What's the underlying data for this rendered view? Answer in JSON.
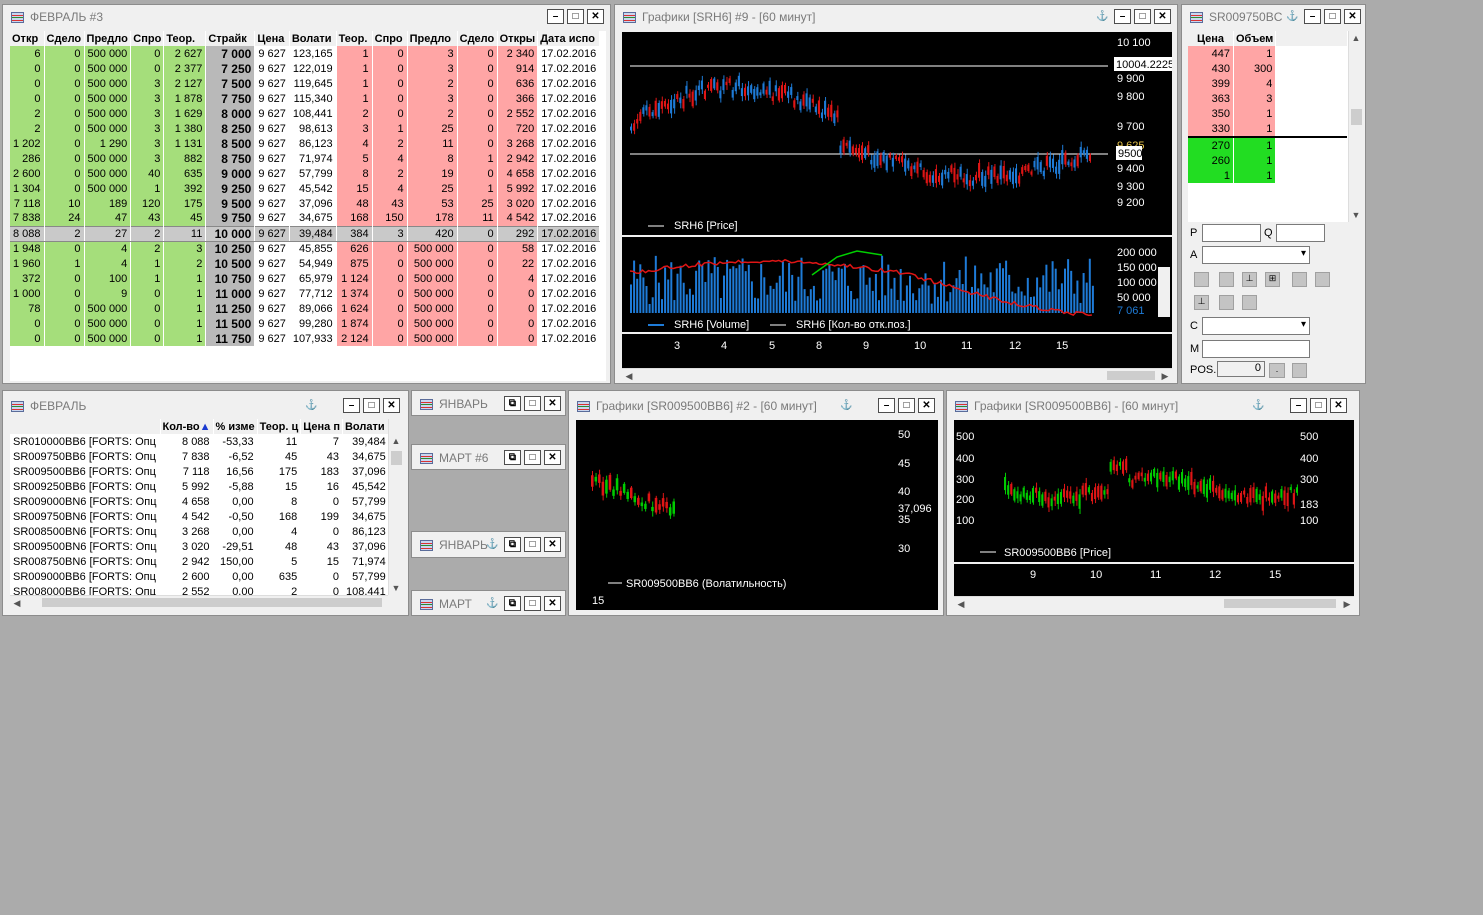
{
  "feb3": {
    "title": "ФЕВРАЛЬ #3",
    "headers": [
      "Откр",
      "Сдело",
      "Предло",
      "Спро",
      "Теор.",
      "Страйк",
      "Цена",
      "Волати",
      "Теор.",
      "Спро",
      "Предло",
      "Сдело",
      "Откры",
      "Дата испо"
    ],
    "rows": [
      [
        "6",
        "0",
        "500 000",
        "0",
        "2 627",
        "7 000",
        "9 627",
        "123,165",
        "1",
        "0",
        "3",
        "0",
        "2 340",
        "17.02.2016"
      ],
      [
        "0",
        "0",
        "500 000",
        "0",
        "2 377",
        "7 250",
        "9 627",
        "122,019",
        "1",
        "0",
        "3",
        "0",
        "914",
        "17.02.2016"
      ],
      [
        "0",
        "0",
        "500 000",
        "3",
        "2 127",
        "7 500",
        "9 627",
        "119,645",
        "1",
        "0",
        "2",
        "0",
        "636",
        "17.02.2016"
      ],
      [
        "0",
        "0",
        "500 000",
        "3",
        "1 878",
        "7 750",
        "9 627",
        "115,340",
        "1",
        "0",
        "3",
        "0",
        "366",
        "17.02.2016"
      ],
      [
        "2",
        "0",
        "500 000",
        "3",
        "1 629",
        "8 000",
        "9 627",
        "108,441",
        "2",
        "0",
        "2",
        "0",
        "2 552",
        "17.02.2016"
      ],
      [
        "2",
        "0",
        "500 000",
        "3",
        "1 380",
        "8 250",
        "9 627",
        "98,613",
        "3",
        "1",
        "25",
        "0",
        "720",
        "17.02.2016"
      ],
      [
        "1 202",
        "0",
        "1 290",
        "3",
        "1 131",
        "8 500",
        "9 627",
        "86,123",
        "4",
        "2",
        "11",
        "0",
        "3 268",
        "17.02.2016"
      ],
      [
        "286",
        "0",
        "500 000",
        "3",
        "882",
        "8 750",
        "9 627",
        "71,974",
        "5",
        "4",
        "8",
        "1",
        "2 942",
        "17.02.2016"
      ],
      [
        "2 600",
        "0",
        "500 000",
        "40",
        "635",
        "9 000",
        "9 627",
        "57,799",
        "8",
        "2",
        "19",
        "0",
        "4 658",
        "17.02.2016"
      ],
      [
        "1 304",
        "0",
        "500 000",
        "1",
        "392",
        "9 250",
        "9 627",
        "45,542",
        "15",
        "4",
        "25",
        "1",
        "5 992",
        "17.02.2016"
      ],
      [
        "7 118",
        "10",
        "189",
        "120",
        "175",
        "9 500",
        "9 627",
        "37,096",
        "48",
        "43",
        "53",
        "25",
        "3 020",
        "17.02.2016"
      ],
      [
        "7 838",
        "24",
        "47",
        "43",
        "45",
        "9 750",
        "9 627",
        "34,675",
        "168",
        "150",
        "178",
        "11",
        "4 542",
        "17.02.2016"
      ],
      [
        "8 088",
        "2",
        "27",
        "2",
        "11",
        "10 000",
        "9 627",
        "39,484",
        "384",
        "3",
        "420",
        "0",
        "292",
        "17.02.2016"
      ],
      [
        "1 948",
        "0",
        "4",
        "2",
        "3",
        "10 250",
        "9 627",
        "45,855",
        "626",
        "0",
        "500 000",
        "0",
        "58",
        "17.02.2016"
      ],
      [
        "1 960",
        "1",
        "4",
        "1",
        "2",
        "10 500",
        "9 627",
        "54,949",
        "875",
        "0",
        "500 000",
        "0",
        "22",
        "17.02.2016"
      ],
      [
        "372",
        "0",
        "100",
        "1",
        "1",
        "10 750",
        "9 627",
        "65,979",
        "1 124",
        "0",
        "500 000",
        "0",
        "4",
        "17.02.2016"
      ],
      [
        "1 000",
        "0",
        "9",
        "0",
        "1",
        "11 000",
        "9 627",
        "77,712",
        "1 374",
        "0",
        "500 000",
        "0",
        "0",
        "17.02.2016"
      ],
      [
        "78",
        "0",
        "500 000",
        "0",
        "1",
        "11 250",
        "9 627",
        "89,066",
        "1 624",
        "0",
        "500 000",
        "0",
        "0",
        "17.02.2016"
      ],
      [
        "0",
        "0",
        "500 000",
        "0",
        "1",
        "11 500",
        "9 627",
        "99,280",
        "1 874",
        "0",
        "500 000",
        "0",
        "0",
        "17.02.2016"
      ],
      [
        "0",
        "0",
        "500 000",
        "0",
        "1",
        "11 750",
        "9 627",
        "107,933",
        "2 124",
        "0",
        "500 000",
        "0",
        "0",
        "17.02.2016"
      ]
    ]
  },
  "srh6": {
    "title": "Графики [SRH6] #9 - [60 минут]",
    "price_ticks": [
      "10 100",
      "9 900",
      "9 800",
      "9 700",
      "9 625",
      "9 400",
      "9 300",
      "9 200"
    ],
    "level_hi": "10004.2225",
    "level_lo": "9500",
    "price_legend": "SRH6 [Price]",
    "vol_ticks": [
      "200 000",
      "150 000",
      "100 000",
      "50 000"
    ],
    "vol_last": "7 061",
    "vol_legend_1": "SRH6 [Volume]",
    "vol_legend_2": "SRH6 [Кол-во отк.поз.]",
    "x_ticks": [
      "3",
      "4",
      "5",
      "8",
      "9",
      "10",
      "11",
      "12",
      "15"
    ],
    "colors": {
      "up": "#1e7bd7",
      "down": "#e01515",
      "oi_up": "#00d000",
      "oi_down": "#e01515"
    }
  },
  "book": {
    "title": "SR009750BC",
    "headers": [
      "Цена",
      "Объем"
    ],
    "asks": [
      [
        "447",
        "1"
      ],
      [
        "430",
        "300"
      ],
      [
        "399",
        "4"
      ],
      [
        "363",
        "3"
      ],
      [
        "350",
        "1"
      ],
      [
        "330",
        "1"
      ]
    ],
    "bids": [
      [
        "270",
        "1"
      ],
      [
        "260",
        "1"
      ],
      [
        "1",
        "1"
      ]
    ],
    "labels": {
      "p": "P",
      "q": "Q",
      "a": "A",
      "c": "C",
      "m": "M",
      "pos": "POS."
    },
    "pos_value": "0"
  },
  "feb": {
    "title": "ФЕВРАЛЬ",
    "headers": [
      "",
      "Кол-во",
      "% изме",
      "Теор. ц",
      "Цена п",
      "Волати"
    ],
    "rows": [
      [
        "SR010000BB6 [FORTS: Опц",
        "8 088",
        "-53,33",
        "11",
        "7",
        "39,484"
      ],
      [
        "SR009750BB6 [FORTS: Опц",
        "7 838",
        "-6,52",
        "45",
        "43",
        "34,675"
      ],
      [
        "SR009500BB6 [FORTS: Опц",
        "7 118",
        "16,56",
        "175",
        "183",
        "37,096"
      ],
      [
        "SR009250BB6 [FORTS: Опц",
        "5 992",
        "-5,88",
        "15",
        "16",
        "45,542"
      ],
      [
        "SR009000BN6 [FORTS: Опц",
        "4 658",
        "0,00",
        "8",
        "0",
        "57,799"
      ],
      [
        "SR009750BN6 [FORTS: Опц",
        "4 542",
        "-0,50",
        "168",
        "199",
        "34,675"
      ],
      [
        "SR008500BN6 [FORTS: Опц",
        "3 268",
        "0,00",
        "4",
        "0",
        "86,123"
      ],
      [
        "SR009500BN6 [FORTS: Опц",
        "3 020",
        "-29,51",
        "48",
        "43",
        "37,096"
      ],
      [
        "SR008750BN6 [FORTS: Опц",
        "2 942",
        "150,00",
        "5",
        "15",
        "71,974"
      ],
      [
        "SR009000BB6 [FORTS: Опц",
        "2 600",
        "0,00",
        "635",
        "0",
        "57,799"
      ],
      [
        "SR008000BB6 [FORTS: Опц",
        "2 552",
        "0,00",
        "2",
        "0",
        "108,441"
      ]
    ]
  },
  "mini": {
    "jan": "ЯНВАРЬ",
    "mar6": "МАРТ #6",
    "jan2": "ЯНВАРЬ",
    "mar": "МАРТ"
  },
  "vol_chart": {
    "title": "Графики [SR009500BB6] #2 - [60 минут]",
    "y_ticks": [
      "50",
      "45",
      "40",
      "37,096",
      "35",
      "30"
    ],
    "legend": "SR009500BB6 (Волатильность)",
    "x_tick": "15"
  },
  "price_chart": {
    "title": "Графики [SR009500BB6] - [60 минут]",
    "y_left": [
      "500",
      "400",
      "300",
      "200",
      "100"
    ],
    "y_right": [
      "500",
      "400",
      "300",
      "183",
      "100"
    ],
    "legend": "SR009500BB6 [Price]",
    "x_ticks": [
      "9",
      "10",
      "11",
      "12",
      "15"
    ]
  }
}
